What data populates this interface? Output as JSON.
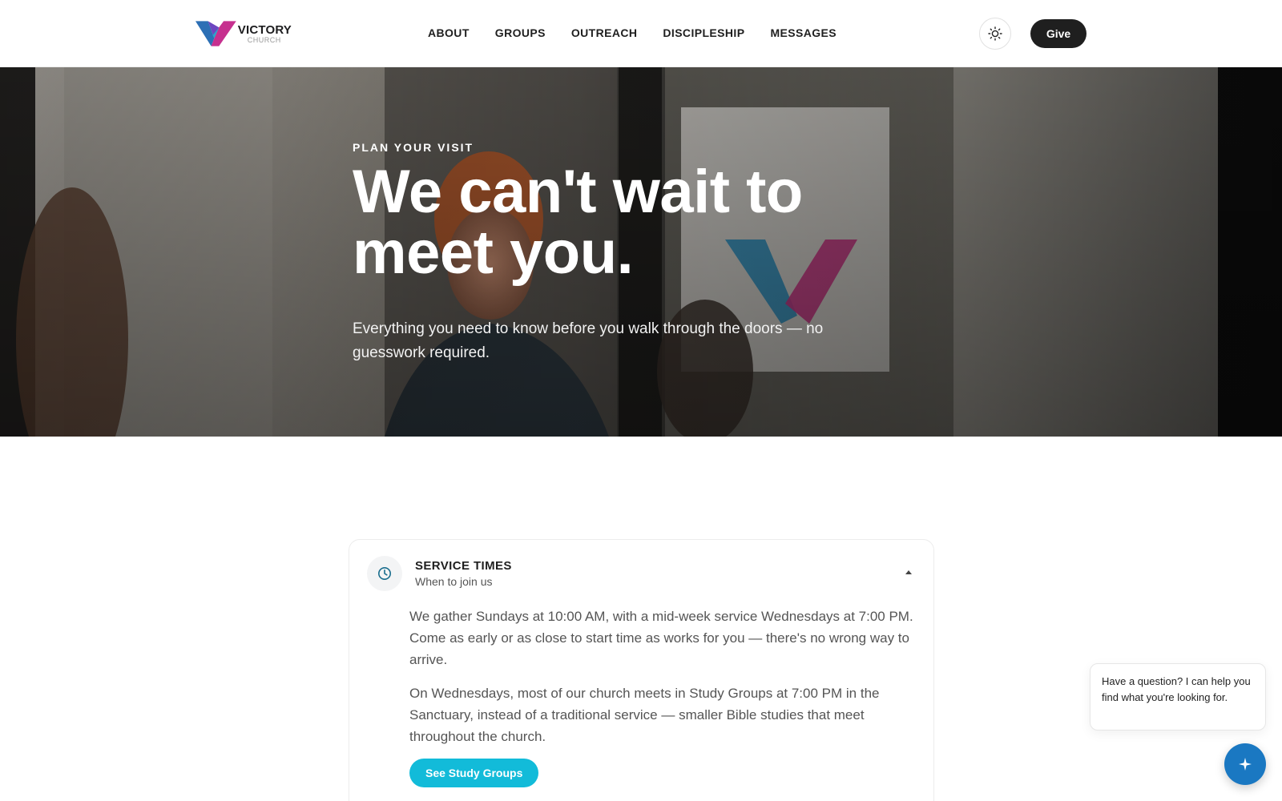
{
  "header": {
    "logo_name": "VICTORY",
    "logo_sub": "CHURCH",
    "nav": [
      "ABOUT",
      "GROUPS",
      "OUTREACH",
      "DISCIPLESHIP",
      "MESSAGES"
    ],
    "theme_icon": "sun-icon",
    "give_label": "Give"
  },
  "hero": {
    "eyebrow": "PLAN YOUR VISIT",
    "title_line1": "We can't wait to",
    "title_line2": "meet you.",
    "subtitle": "Everything you need to know before you walk through the doors — no guesswork required."
  },
  "service_times": {
    "icon": "clock-icon",
    "title": "SERVICE TIMES",
    "subtitle": "When to join us",
    "paragraph1": "We gather Sundays at 10:00 AM, with a mid-week service Wednesdays at 7:00 PM. Come as early or as close to start time as works for you — there's no wrong way to arrive.",
    "paragraph2": "On Wednesdays, most of our church meets in Study Groups at 7:00 PM in the Sanctuary, instead of a traditional service — smaller Bible studies that meet throughout the church.",
    "cta_label": "See Study Groups"
  },
  "chat": {
    "message": "Have a question? I can help you find what you're looking for.",
    "fab_icon": "sparkle-icon"
  },
  "colors": {
    "accent_cyan": "#12bbd9",
    "chat_blue": "#1a78c2",
    "dark": "#1f1f1f"
  }
}
